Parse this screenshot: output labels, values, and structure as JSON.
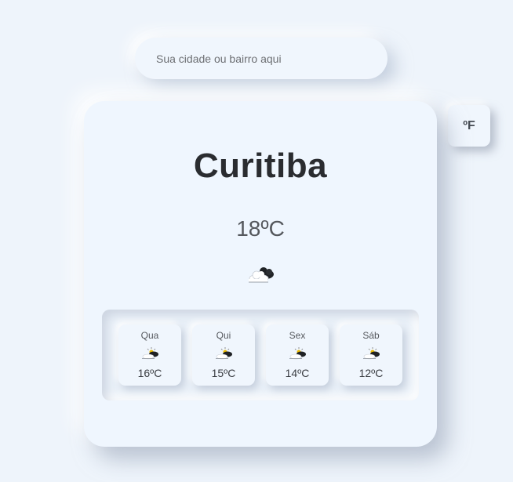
{
  "search": {
    "placeholder": "Sua cidade ou bairro aqui",
    "value": ""
  },
  "unit_toggle": {
    "label": "ºF"
  },
  "weather": {
    "city": "Curitiba",
    "temperature": "18ºC",
    "icon": "partly-cloudy-icon"
  },
  "forecast": [
    {
      "day": "Qua",
      "temp": "16ºC",
      "icon": "sun-behind-cloud-icon"
    },
    {
      "day": "Qui",
      "temp": "15ºC",
      "icon": "sun-behind-cloud-icon"
    },
    {
      "day": "Sex",
      "temp": "14ºC",
      "icon": "sun-behind-cloud-icon"
    },
    {
      "day": "Sáb",
      "temp": "12ºC",
      "icon": "sun-behind-cloud-icon"
    }
  ],
  "colors": {
    "background": "#eef4fb",
    "card": "#eff6fe",
    "text_dark": "#2a2c30",
    "text_muted": "#55585d"
  }
}
